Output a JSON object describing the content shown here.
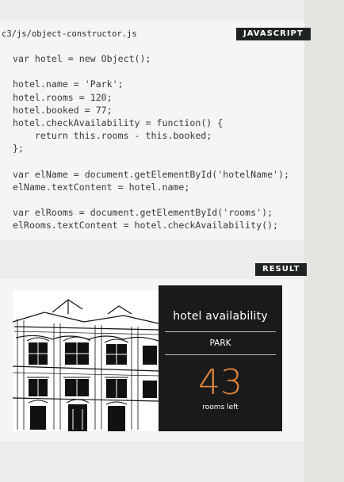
{
  "code_example": {
    "file_path": "c3/js/object-constructor.js",
    "tag": "JAVASCRIPT",
    "lines": [
      "var hotel = new Object();",
      "",
      "hotel.name = 'Park';",
      "hotel.rooms = 120;",
      "hotel.booked = 77;",
      "hotel.checkAvailability = function() {",
      "    return this.rooms - this.booked;",
      "};",
      "",
      "var elName = document.getElementById('hotelName');",
      "elName.textContent = hotel.name;",
      "",
      "var elRooms = document.getElementById('rooms');",
      "elRooms.textContent = hotel.checkAvailability();"
    ]
  },
  "result": {
    "tag": "RESULT",
    "card": {
      "title": "hotel availability",
      "hotel_name": "PARK",
      "rooms_left": "43",
      "rooms_label": "rooms left"
    }
  },
  "colors": {
    "page_bg": "#ececea",
    "panel_bg": "#f5f5f3",
    "tag_bg": "#1f2422",
    "card_bg": "#1a1a1a",
    "accent": "#e0853a"
  }
}
